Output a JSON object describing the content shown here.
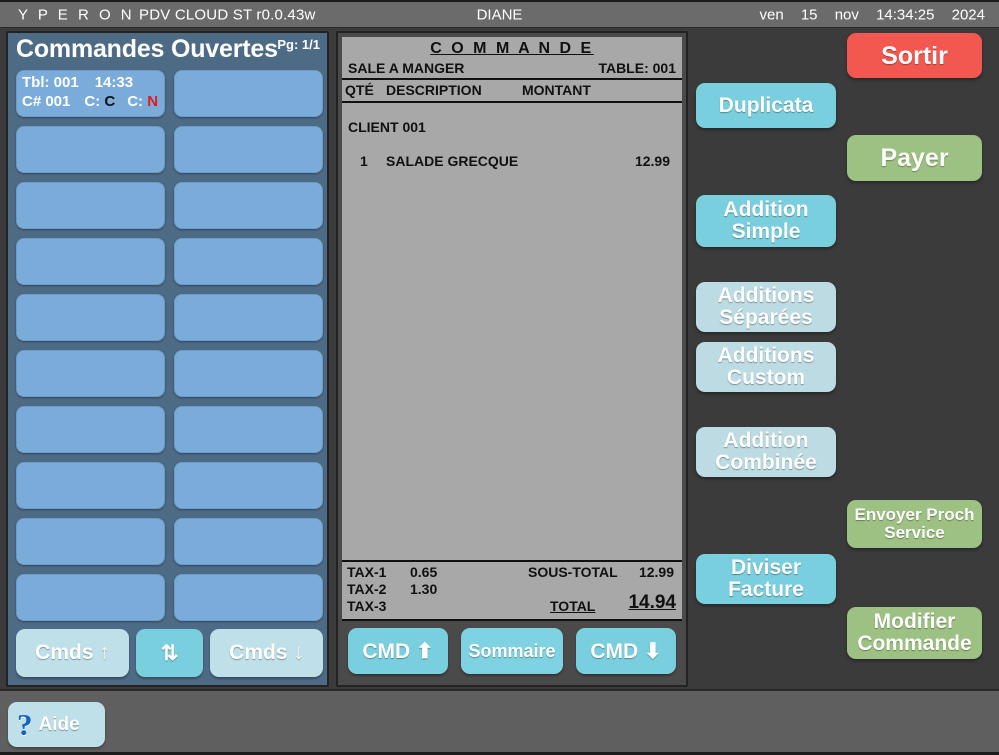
{
  "titlebar": {
    "brand": "Y P E R O N",
    "product": "PDV",
    "mode": "CLOUD",
    "station": "ST",
    "version": "r0.0.43w",
    "user": "DIANE",
    "day": "ven",
    "date": "15",
    "month": "nov",
    "time": "14:34:25",
    "year": "2024"
  },
  "sidebar": {
    "title": "Commandes Ouvertes",
    "page": "Pg: 1/1",
    "tiles": [
      {
        "occupied": true,
        "table_label": "Tbl: 001",
        "time": "14:33",
        "check_label": "C# 001",
        "c1_label": "C:",
        "c1_value": "C",
        "c2_label": "C:",
        "c2_value": "N"
      },
      {
        "occupied": false
      },
      {
        "occupied": false
      },
      {
        "occupied": false
      },
      {
        "occupied": false
      },
      {
        "occupied": false
      },
      {
        "occupied": false
      },
      {
        "occupied": false
      },
      {
        "occupied": false
      },
      {
        "occupied": false
      },
      {
        "occupied": false
      },
      {
        "occupied": false
      },
      {
        "occupied": false
      },
      {
        "occupied": false
      },
      {
        "occupied": false
      },
      {
        "occupied": false
      },
      {
        "occupied": false
      },
      {
        "occupied": false
      },
      {
        "occupied": false
      },
      {
        "occupied": false
      }
    ],
    "nav": {
      "prev_label": "Cmds ↑",
      "toggle_label": "⇅",
      "next_label": "Cmds ↓"
    }
  },
  "receipt": {
    "title": "C O M M A N D E",
    "room": "SALE A MANGER",
    "table": "TABLE: 001",
    "columns": {
      "qty": "QTÉ",
      "description": "DESCRIPTION",
      "amount": "MONTANT"
    },
    "client": "CLIENT 001",
    "items": [
      {
        "qty": "1",
        "description": "SALADE GRECQUE",
        "amount": "12.99"
      }
    ],
    "taxes": [
      {
        "label": "TAX-1",
        "value": "0.65"
      },
      {
        "label": "TAX-2",
        "value": "1.30"
      },
      {
        "label": "TAX-3",
        "value": ""
      }
    ],
    "subtotal_label": "SOUS-TOTAL",
    "subtotal_value": "12.99",
    "total_label": "TOTAL",
    "total_value": "14.94",
    "actions": {
      "cmd_up": "CMD ⬆",
      "summary": "Sommaire",
      "cmd_down": "CMD ⬇"
    }
  },
  "actions": {
    "exit": "Sortir",
    "duplicate": "Duplicata",
    "pay": "Payer",
    "simple_bill": "Addition Simple",
    "separate_bills": "Additions Séparées",
    "custom_bills": "Additions Custom",
    "combined_bill": "Addition Combinée",
    "send_next_service": "Envoyer Proch Service",
    "split_bill": "Diviser Facture",
    "modify_order": "Modifier Commande"
  },
  "statusbar": {
    "help_label": "Aide",
    "help_icon": "question-mark-icon"
  },
  "colors": {
    "accent_cyan": "#7acfdf",
    "muted_cyan": "#bcdbe3",
    "danger_red": "#f2584f",
    "success_green": "#9dc183",
    "tile_blue": "#7bacd9",
    "sidebar_blue": "#4e6b86",
    "paper_gray": "#a8a8a8"
  }
}
